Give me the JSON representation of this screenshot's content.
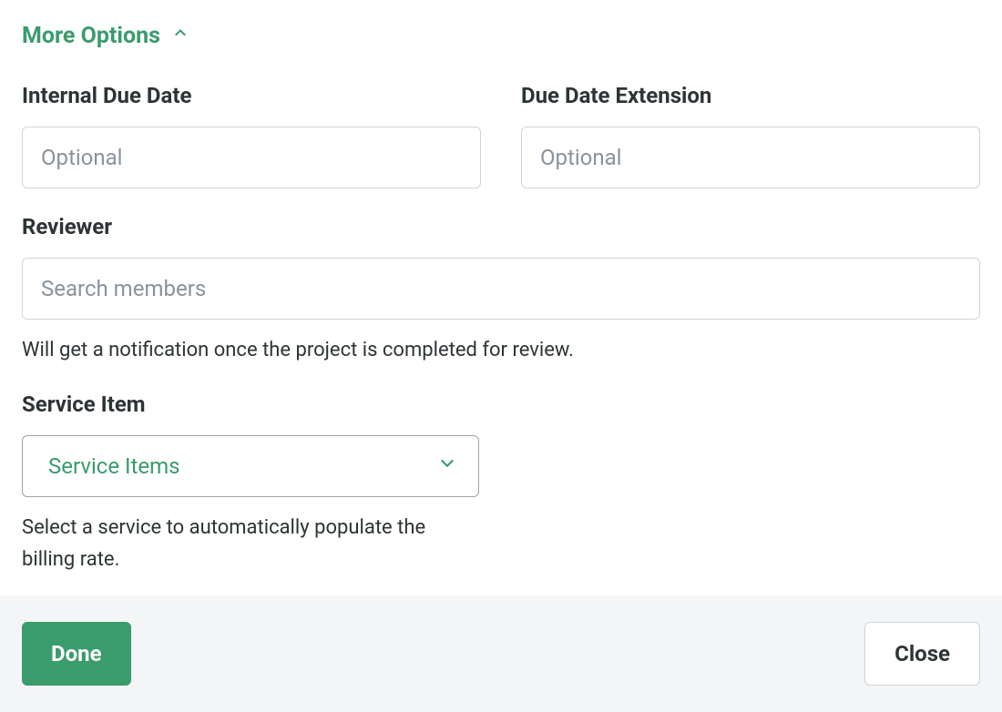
{
  "moreOptions": {
    "label": "More Options"
  },
  "fields": {
    "internalDueDate": {
      "label": "Internal Due Date",
      "placeholder": "Optional"
    },
    "dueDateExtension": {
      "label": "Due Date Extension",
      "placeholder": "Optional"
    },
    "reviewer": {
      "label": "Reviewer",
      "placeholder": "Search members",
      "helper": "Will get a notification once the project is completed for review."
    },
    "serviceItem": {
      "label": "Service Item",
      "selected": "Service Items",
      "helper": "Select a service to automatically populate the billing rate."
    }
  },
  "footer": {
    "done": "Done",
    "close": "Close"
  }
}
